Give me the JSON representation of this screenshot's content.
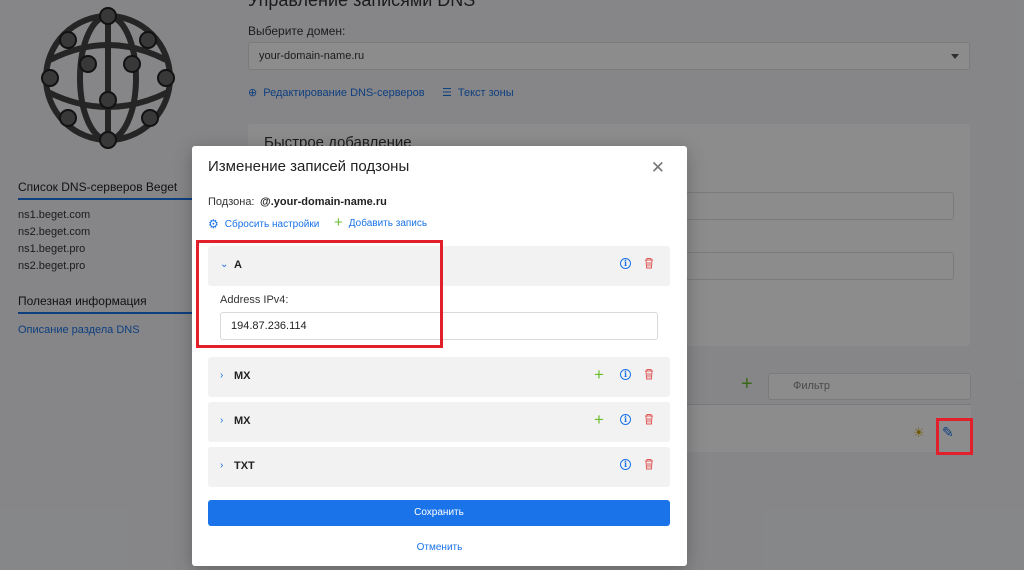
{
  "background": {
    "page_title": "Управление записями DNS",
    "domain_label": "Выберите домен:",
    "domain_value": "your-domain-name.ru",
    "links": {
      "edit_dns": "Редактирование DNS-серверов",
      "zone_text": "Текст зоны"
    },
    "panel_title": "Быстрое добавление",
    "filter_placeholder": "Фильтр",
    "sidebar": {
      "dns_list_title": "Список DNS-серверов Beget",
      "ns": [
        "ns1.beget.com",
        "ns2.beget.com",
        "ns1.beget.pro",
        "ns2.beget.pro"
      ],
      "useful_title": "Полезная информация",
      "useful_link": "Описание раздела DNS"
    }
  },
  "modal": {
    "title": "Изменение записей подзоны",
    "subzone_label": "Подзона:",
    "subzone_value": "@.your-domain-name.ru",
    "reset_label": "Сбросить настройки",
    "add_label": "Добавить запись",
    "records": [
      {
        "type": "A",
        "expanded": true,
        "field_label": "Address IPv4:",
        "field_value": "194.87.236.114"
      },
      {
        "type": "MX",
        "expanded": false
      },
      {
        "type": "MX",
        "expanded": false
      },
      {
        "type": "TXT",
        "expanded": false
      }
    ],
    "save_label": "Сохранить",
    "cancel_label": "Отменить"
  },
  "colors": {
    "accent": "#1a73e8",
    "add_green": "#6bbf2f",
    "delete_red": "#e05a5a",
    "highlight_red": "#e2202b"
  },
  "icons": [
    "globe-logo",
    "gear-icon",
    "list-icon",
    "plus-icon",
    "info-icon",
    "trash-icon",
    "chevron-icon",
    "close-icon",
    "search-icon",
    "sun-icon",
    "pencil-icon"
  ]
}
